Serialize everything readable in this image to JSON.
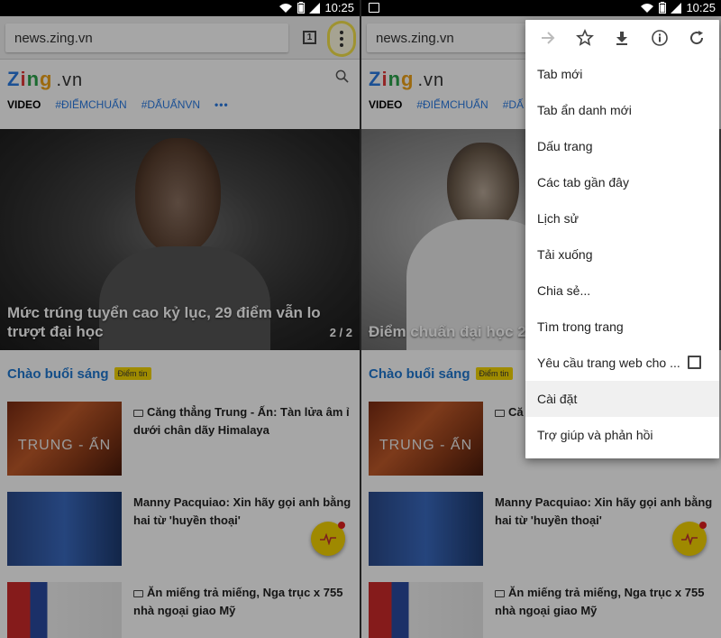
{
  "status": {
    "time": "10:25"
  },
  "left": {
    "url": "news.zing.vn",
    "tab_count": "1",
    "logo": {
      "z": "Z",
      "i": "i",
      "n": "n",
      "g": "g",
      "vn": ".vn"
    },
    "nav": {
      "video": "VIDEO",
      "tag1": "#ĐIỂMCHUẨN",
      "tag2": "#DẤUẤNVN",
      "more": "•••"
    },
    "hero": {
      "caption": "Mức trúng tuyển cao kỷ lục, 29 điểm vẫn lo trượt đại học",
      "pager": "2 / 2"
    },
    "greeting": "Chào buổi sáng",
    "badge": "Điểm tin",
    "articles": [
      {
        "title": "Căng thẳng Trung - Ấn: Tàn lửa âm ỉ dưới chân dãy Himalaya",
        "thumb_text": "TRUNG - ẤN"
      },
      {
        "title": "Manny Pacquiao: Xin hãy gọi anh bằng hai từ 'huyền thoại'"
      },
      {
        "title": "Ăn miếng trả miếng, Nga trục x 755 nhà ngoại giao Mỹ"
      }
    ]
  },
  "right": {
    "url": "news.zing.vn",
    "logo": {
      "z": "Z",
      "i": "i",
      "n": "n",
      "g": "g",
      "vn": ".vn"
    },
    "nav": {
      "video": "VIDEO",
      "tag1": "#ĐIỂMCHUẨN",
      "tag2": "#DẤ"
    },
    "hero": {
      "caption": "Điểm chuẩn đại học 2"
    },
    "greeting": "Chào buổi sáng",
    "badge": "Điểm tin",
    "articles": [
      {
        "title": "Că dưới",
        "thumb_text": "TRUNG - ẤN"
      },
      {
        "title": "Manny Pacquiao: Xin hãy gọi anh bằng hai từ 'huyền thoại'"
      },
      {
        "title": "Ăn miếng trả miếng, Nga trục x 755 nhà ngoại giao Mỹ"
      }
    ],
    "menu": {
      "icons": [
        "forward-icon",
        "star-icon",
        "download-icon",
        "info-icon",
        "reload-icon"
      ],
      "items": [
        "Tab mới",
        "Tab ẩn danh mới",
        "Dấu trang",
        "Các tab gần đây",
        "Lịch sử",
        "Tải xuống",
        "Chia sẻ...",
        "Tìm trong trang",
        "Yêu cầu trang web cho ...",
        "Cài đặt",
        "Trợ giúp và phản hồi"
      ],
      "selected_index": 9
    }
  },
  "colors": {
    "accent": "#1f78d1",
    "highlight": "#f4e24a",
    "fab": "#f4d300"
  }
}
